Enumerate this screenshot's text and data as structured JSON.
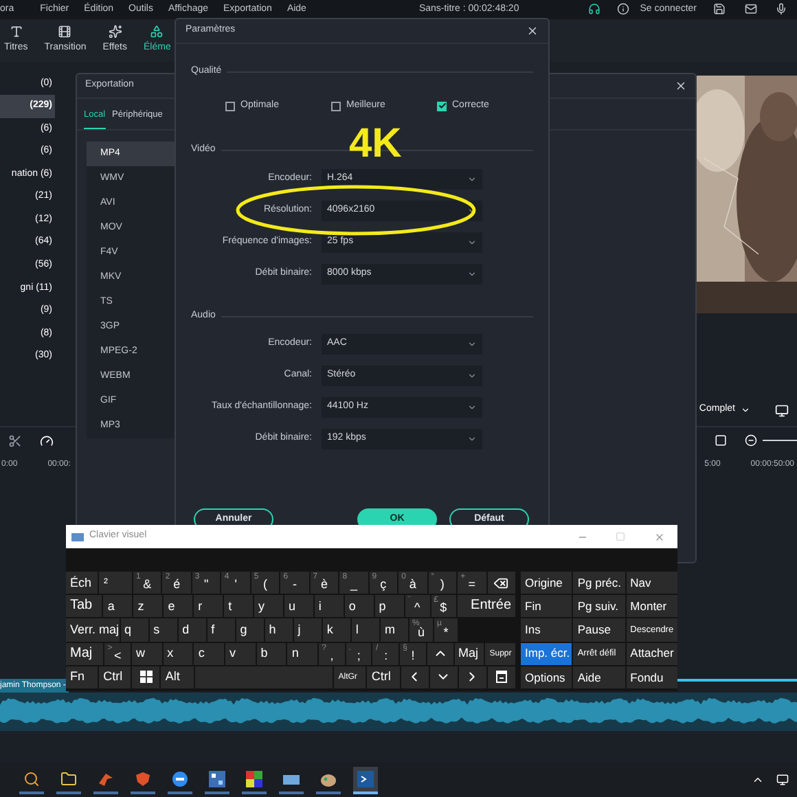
{
  "app": {
    "menu": [
      "ora",
      "Fichier",
      "Édition",
      "Outils",
      "Affichage",
      "Exportation",
      "Aide"
    ],
    "title": "Sans-titre : 00:02:48:20",
    "account": "Se connecter",
    "toolbar": [
      {
        "label": "Titres",
        "selected": false
      },
      {
        "label": "Transition",
        "selected": false
      },
      {
        "label": "Effets",
        "selected": false
      },
      {
        "label": "Éléme",
        "selected": true
      }
    ],
    "categories": [
      {
        "label": "(0)",
        "selected": false
      },
      {
        "label": "(229)",
        "selected": true
      },
      {
        "label": "(6)",
        "selected": false
      },
      {
        "label": "(6)",
        "selected": false
      },
      {
        "label": "nation (6)",
        "selected": false
      },
      {
        "label": "(21)",
        "selected": false
      },
      {
        "label": "(12)",
        "selected": false
      },
      {
        "label": "(64)",
        "selected": false
      },
      {
        "label": "(56)",
        "selected": false
      },
      {
        "label": "gni (11)",
        "selected": false
      },
      {
        "label": "(9)",
        "selected": false
      },
      {
        "label": "(8)",
        "selected": false
      },
      {
        "label": "(30)",
        "selected": false
      }
    ],
    "zoom": "Complet",
    "ruler_left": [
      "0:00",
      "00:00:"
    ],
    "ruler_right": [
      "5:00",
      "00:00:50:00"
    ],
    "clip": "jamin Thompson -",
    "taskbar": [
      {
        "selected": false
      },
      {
        "selected": false
      },
      {
        "selected": false
      },
      {
        "selected": false
      },
      {
        "selected": false
      },
      {
        "selected": false
      },
      {
        "selected": false
      },
      {
        "selected": false
      },
      {
        "selected": false
      },
      {
        "selected": true
      }
    ]
  },
  "export_window": {
    "title": "Exportation",
    "tabs": [
      {
        "label": "Local",
        "selected": true
      },
      {
        "label": "Périphérique",
        "selected": false
      }
    ],
    "formats": [
      {
        "label": "MP4",
        "selected": true
      },
      {
        "label": "WMV",
        "selected": false
      },
      {
        "label": "AVI",
        "selected": false
      },
      {
        "label": "MOV",
        "selected": false
      },
      {
        "label": "F4V",
        "selected": false
      },
      {
        "label": "MKV",
        "selected": false
      },
      {
        "label": "TS",
        "selected": false
      },
      {
        "label": "3GP",
        "selected": false
      },
      {
        "label": "MPEG-2",
        "selected": false
      },
      {
        "label": "WEBM",
        "selected": false
      },
      {
        "label": "GIF",
        "selected": false
      },
      {
        "label": "MP3",
        "selected": false
      }
    ]
  },
  "settings_dialog": {
    "title": "Paramètres",
    "quality": {
      "heading": "Qualité",
      "options": [
        {
          "label": "Optimale",
          "checked": false
        },
        {
          "label": "Meilleure",
          "checked": false
        },
        {
          "label": "Correcte",
          "checked": true
        }
      ]
    },
    "video": {
      "heading": "Vidéo",
      "fields": [
        {
          "label": "Encodeur:",
          "value": "H.264"
        },
        {
          "label": "Résolution:",
          "value": "4096x2160"
        },
        {
          "label": "Fréquence d'images:",
          "value": "25 fps"
        },
        {
          "label": "Débit binaire:",
          "value": "8000 kbps"
        }
      ]
    },
    "audio": {
      "heading": "Audio",
      "fields": [
        {
          "label": "Encodeur:",
          "value": "AAC"
        },
        {
          "label": "Canal:",
          "value": "Stéréo"
        },
        {
          "label": "Taux d'échantillonnage:",
          "value": "44100 Hz"
        },
        {
          "label": "Débit binaire:",
          "value": "192 kbps"
        }
      ]
    },
    "buttons": [
      {
        "label": "Annuler",
        "kind": "outline"
      },
      {
        "label": "OK",
        "kind": "primary"
      },
      {
        "label": "Défaut",
        "kind": "outline"
      }
    ]
  },
  "annotation": {
    "text": "4K"
  },
  "keyboard": {
    "title": "Clavier visuel",
    "rows": [
      [
        {
          "kind": "key",
          "label": "Éch"
        },
        {
          "kind": "key",
          "label": "²"
        },
        {
          "kind": "key",
          "shift": "1",
          "label": "&"
        },
        {
          "kind": "key",
          "shift": "2",
          "label": "é"
        },
        {
          "kind": "key",
          "shift": "3",
          "label": "\""
        },
        {
          "kind": "key",
          "shift": "4",
          "label": "'"
        },
        {
          "kind": "key",
          "shift": "5",
          "label": "("
        },
        {
          "kind": "key",
          "shift": "6",
          "label": "-"
        },
        {
          "kind": "key",
          "shift": "7",
          "label": "è"
        },
        {
          "kind": "key",
          "shift": "8",
          "label": "_"
        },
        {
          "kind": "key",
          "shift": "9",
          "label": "ç"
        },
        {
          "kind": "key",
          "shift": "0",
          "label": "à"
        },
        {
          "kind": "key",
          "shift": "°",
          "label": ")"
        },
        {
          "kind": "key",
          "shift": "+",
          "label": "="
        },
        {
          "kind": "backspace"
        }
      ],
      [
        {
          "kind": "wide",
          "label": "Tab"
        },
        {
          "kind": "key",
          "label": "a"
        },
        {
          "kind": "key",
          "label": "z"
        },
        {
          "kind": "key",
          "label": "e"
        },
        {
          "kind": "key",
          "label": "r"
        },
        {
          "kind": "key",
          "label": "t"
        },
        {
          "kind": "key",
          "label": "y"
        },
        {
          "kind": "key",
          "label": "u"
        },
        {
          "kind": "key",
          "label": "i"
        },
        {
          "kind": "key",
          "label": "o"
        },
        {
          "kind": "key",
          "label": "p"
        },
        {
          "kind": "key",
          "shift": "¨",
          "label": "^"
        },
        {
          "kind": "key",
          "shift": "£",
          "label": "$"
        },
        {
          "kind": "enter",
          "label": "Entrée"
        }
      ],
      [
        {
          "kind": "caps",
          "label": "Verr. maj"
        },
        {
          "kind": "key",
          "label": "q"
        },
        {
          "kind": "key",
          "label": "s"
        },
        {
          "kind": "key",
          "label": "d"
        },
        {
          "kind": "key",
          "label": "f"
        },
        {
          "kind": "key",
          "label": "g"
        },
        {
          "kind": "key",
          "label": "h"
        },
        {
          "kind": "key",
          "label": "j"
        },
        {
          "kind": "key",
          "label": "k"
        },
        {
          "kind": "key",
          "label": "l"
        },
        {
          "kind": "key",
          "label": "m"
        },
        {
          "kind": "key",
          "shift": "%",
          "label": "ù"
        },
        {
          "kind": "key",
          "shift": "µ",
          "label": "*"
        },
        {
          "kind": "gap"
        }
      ],
      [
        {
          "kind": "wide",
          "label": "Maj"
        },
        {
          "kind": "key",
          "shift": ">",
          "label": "<"
        },
        {
          "kind": "key",
          "label": "w"
        },
        {
          "kind": "key",
          "label": "x"
        },
        {
          "kind": "key",
          "label": "c"
        },
        {
          "kind": "key",
          "label": "v"
        },
        {
          "kind": "key",
          "label": "b"
        },
        {
          "kind": "key",
          "label": "n"
        },
        {
          "kind": "key",
          "shift": "?",
          "label": ","
        },
        {
          "kind": "key",
          "shift": ".",
          "label": ";"
        },
        {
          "kind": "key",
          "shift": "/",
          "label": ":"
        },
        {
          "kind": "key",
          "shift": "§",
          "label": "!"
        },
        {
          "kind": "arrow-up"
        },
        {
          "kind": "key",
          "label": "Maj"
        },
        {
          "kind": "small",
          "label": "Suppr"
        }
      ],
      [
        {
          "kind": "key",
          "label": "Fn"
        },
        {
          "kind": "key",
          "label": "Ctrl"
        },
        {
          "kind": "windows"
        },
        {
          "kind": "key",
          "label": "Alt"
        }
      ]
    ],
    "bottom_right": [
      {
        "kind": "small",
        "label": "AltGr"
      },
      {
        "kind": "key",
        "label": "Ctrl"
      },
      {
        "kind": "arrow-left"
      },
      {
        "kind": "arrow-down"
      },
      {
        "kind": "arrow-right"
      },
      {
        "kind": "menu"
      }
    ],
    "nav_rows": [
      [
        {
          "label": "Origine",
          "kind": "key",
          "on": false
        },
        {
          "label": "Pg préc.",
          "kind": "key",
          "on": false
        },
        {
          "label": "Nav",
          "kind": "key",
          "on": false
        }
      ],
      [
        {
          "label": "Fin",
          "kind": "key",
          "on": false
        },
        {
          "label": "Pg suiv.",
          "kind": "key",
          "on": false
        },
        {
          "label": "Monter",
          "kind": "key",
          "on": false
        }
      ],
      [
        {
          "label": "Ins",
          "kind": "key",
          "on": false
        },
        {
          "label": "Pause",
          "kind": "key",
          "on": false
        },
        {
          "label": "Descendre",
          "kind": "small",
          "on": false
        }
      ],
      [
        {
          "label": "Imp. écr.",
          "kind": "key",
          "on": true
        },
        {
          "label": "Arrêt défil",
          "kind": "small",
          "on": false
        },
        {
          "label": "Attacher",
          "kind": "key",
          "on": false
        }
      ],
      [
        {
          "label": "Options",
          "kind": "key",
          "on": false
        },
        {
          "label": "Aide",
          "kind": "key",
          "on": false
        },
        {
          "label": "Fondu",
          "kind": "key",
          "on": false
        }
      ]
    ]
  }
}
